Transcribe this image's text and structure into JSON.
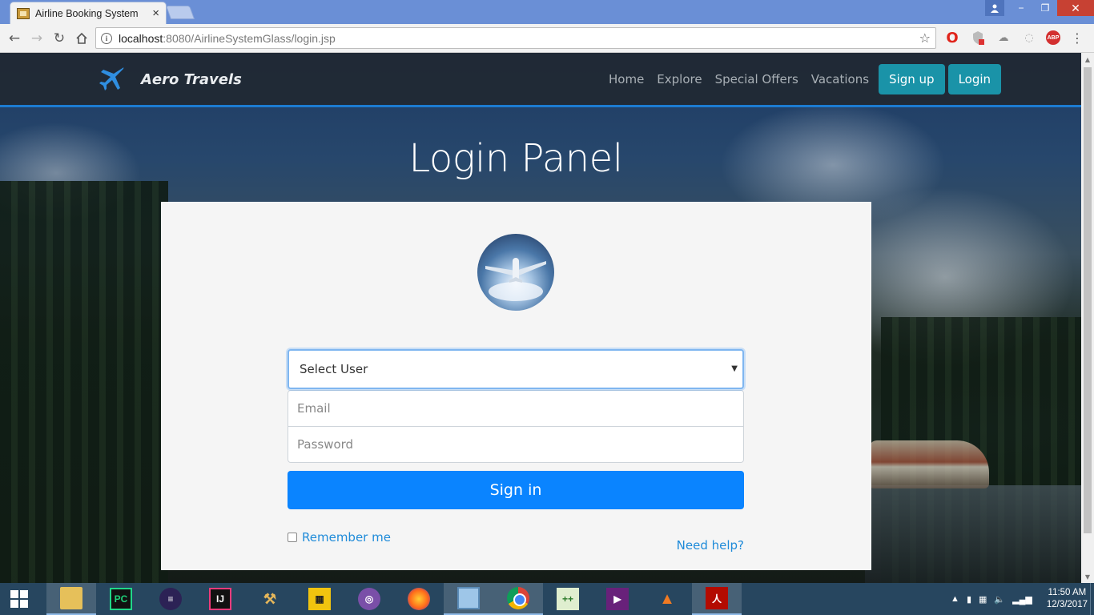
{
  "browser": {
    "tab_title": "Airline Booking System",
    "tab_close": "×",
    "url_host": "localhost",
    "url_rest": ":8080/AirlineSystemGlass/login.jsp",
    "window_controls": {
      "minimize": "−",
      "restore": "❐",
      "close": "✕"
    }
  },
  "site": {
    "brand": "Aero Travels",
    "nav": [
      "Home",
      "Explore",
      "Special Offers",
      "Vacations"
    ],
    "signup": "Sign up",
    "login": "Login",
    "accent": "#1c7bd1",
    "cta_color": "#1a93a8"
  },
  "login_panel": {
    "title": "Login Panel",
    "select_user": "Select User",
    "email_placeholder": "Email",
    "password_placeholder": "Password",
    "signin": "Sign in",
    "remember": "Remember me",
    "help": "Need help?",
    "primary_color": "#0a84ff"
  },
  "taskbar": {
    "apps": [
      "file-explorer-icon",
      "pycharm-icon",
      "eclipse-icon",
      "intellij-icon",
      "tools-icon",
      "puzzle-icon",
      "tor-icon",
      "firefox-icon",
      "virtualbox-icon",
      "chrome-icon",
      "notepadpp-icon",
      "visual-studio-icon",
      "matlab-icon",
      "acrobat-icon"
    ],
    "time": "11:50 AM",
    "date": "12/3/2017"
  }
}
